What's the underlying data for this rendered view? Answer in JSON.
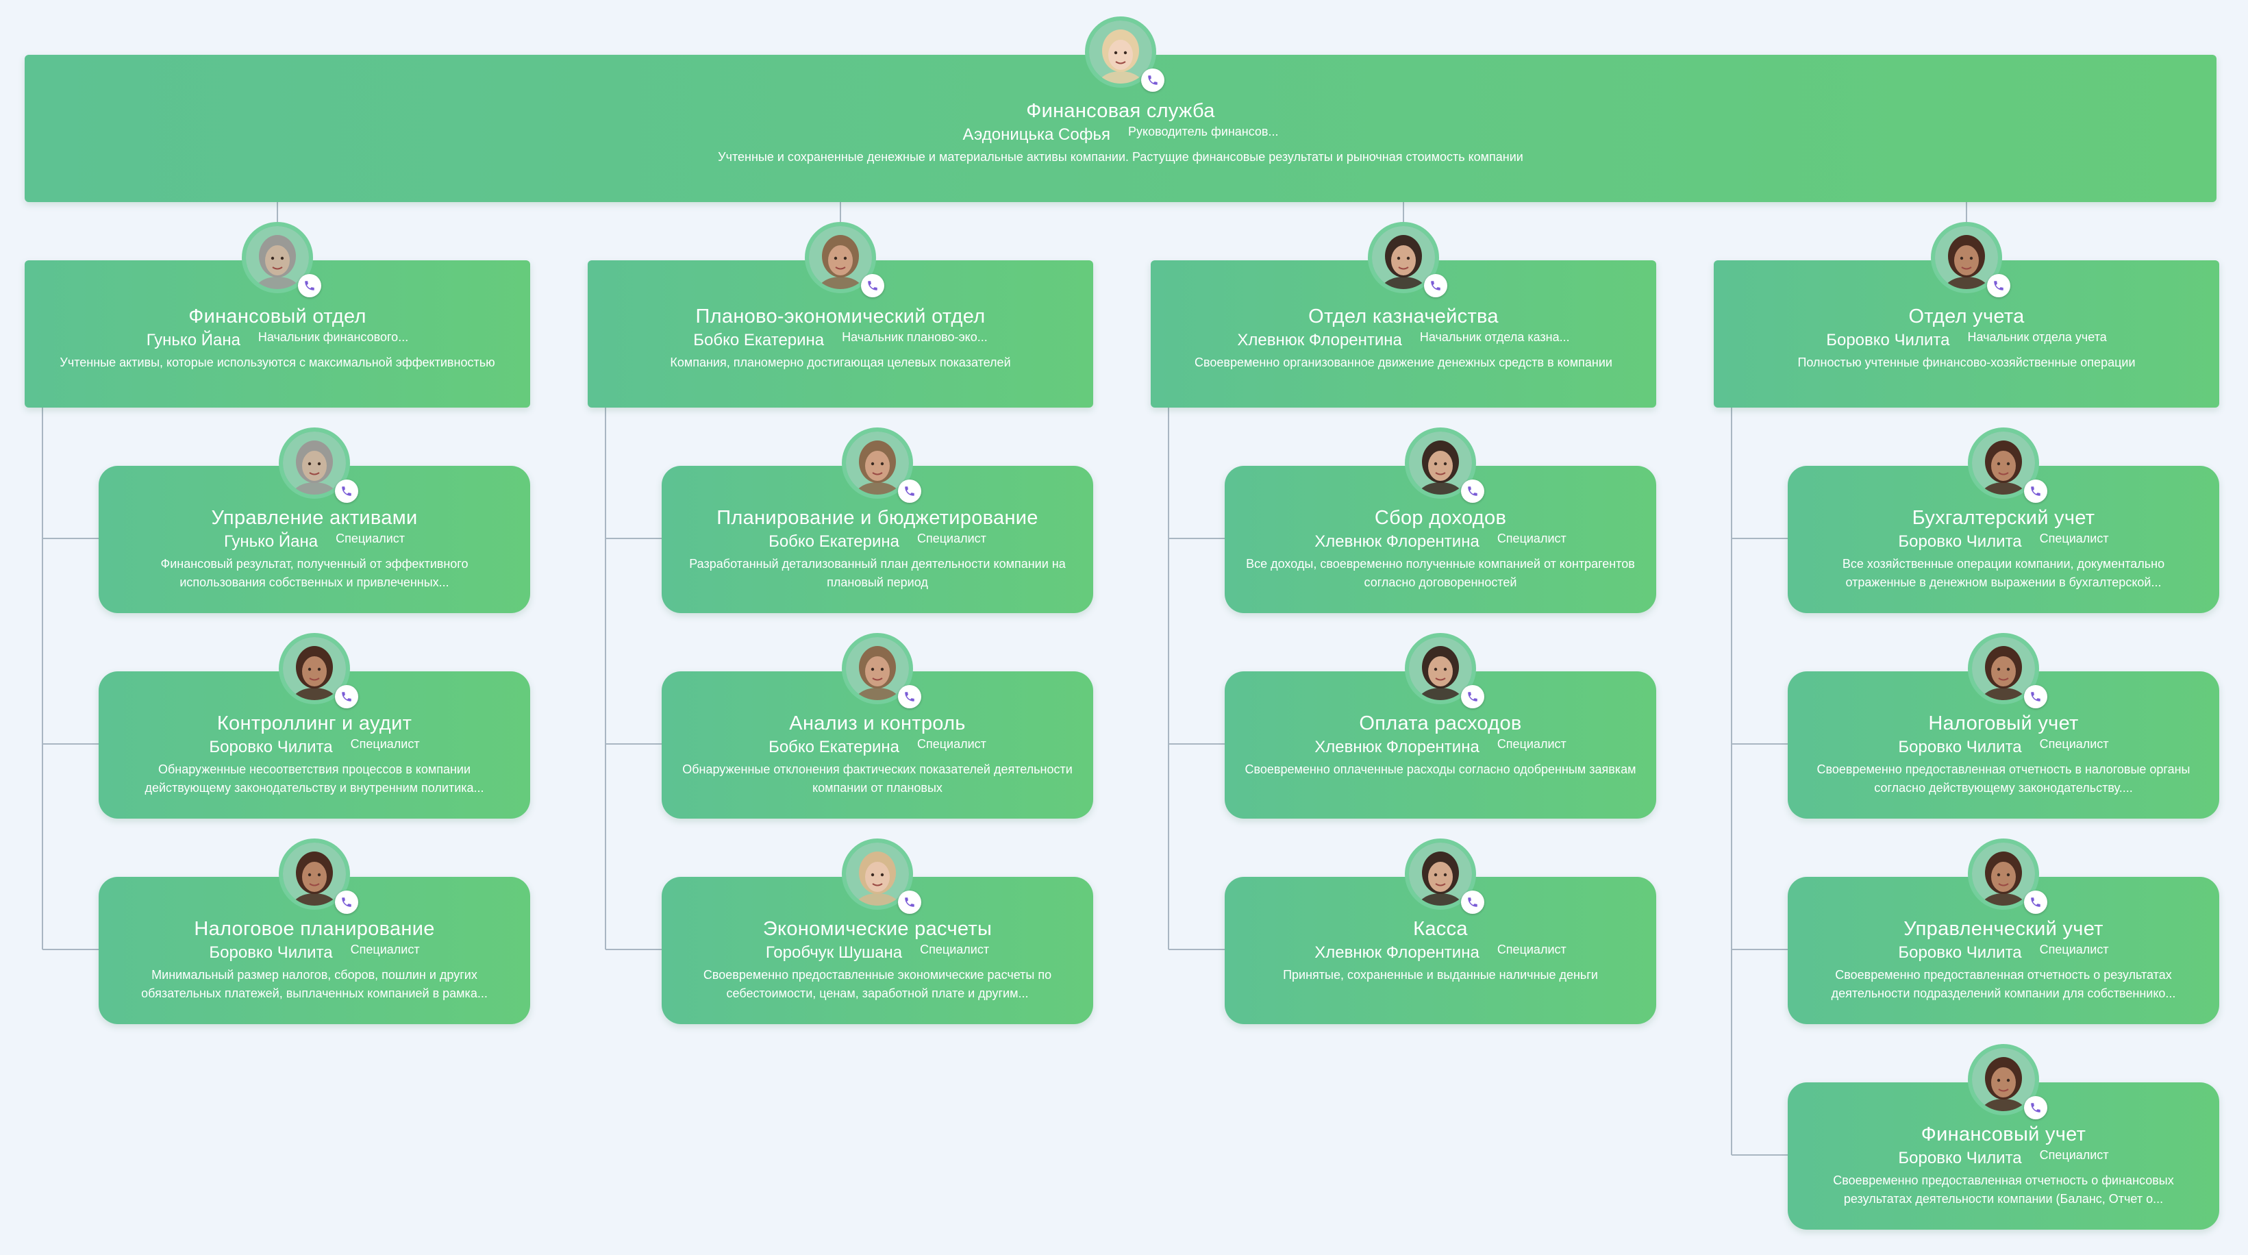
{
  "root": {
    "title": "Финансовая служба",
    "name": "Аэдоницька Софья",
    "role": "Руководитель финансов...",
    "desc": "Учтенные и сохраненные денежные и материальные активы компании. Растущие финансовые результаты и рыночная стоимость компании",
    "avatar": "person-2"
  },
  "departments": [
    {
      "title": "Финансовый отдел",
      "name": "Гунько Йана",
      "role": "Начальник финансового...",
      "desc": "Учтенные активы, которые используются с максимальной эффективностью",
      "avatar": "person-1",
      "teams": [
        {
          "title": "Управление активами",
          "name": "Гунько Йана",
          "role": "Специалист",
          "desc": "Финансовый результат, полученный от эффективного использования собственных и привлеченных...",
          "avatar": "person-1"
        },
        {
          "title": "Контроллинг и аудит",
          "name": "Боровко Чилита",
          "role": "Специалист",
          "desc": "Обнаруженные несоответствия процессов в компании действующему законодательству и внутренним политика...",
          "avatar": "person-3"
        },
        {
          "title": "Налоговое планирование",
          "name": "Боровко Чилита",
          "role": "Специалист",
          "desc": "Минимальный размер налогов, сборов, пошлин и других обязательных платежей, выплаченных компанией в рамка...",
          "avatar": "person-3"
        }
      ]
    },
    {
      "title": "Планово-экономический отдел",
      "name": "Бобко Екатерина",
      "role": "Начальник планово-эко...",
      "desc": "Компания, планомерно достигающая целевых показателей",
      "avatar": "person-4",
      "teams": [
        {
          "title": "Планирование и бюджетирование",
          "name": "Бобко Екатерина",
          "role": "Специалист",
          "desc": "Разработанный детализованный план деятельности компании на плановый период",
          "avatar": "person-4"
        },
        {
          "title": "Анализ и контроль",
          "name": "Бобко Екатерина",
          "role": "Специалист",
          "desc": "Обнаруженные отклонения фактических показателей деятельности компании от плановых",
          "avatar": "person-4"
        },
        {
          "title": "Экономические расчеты",
          "name": "Горобчук Шушана",
          "role": "Специалист",
          "desc": "Своевременно предоставленные экономические расчеты по себестоимости, ценам, заработной плате и другим...",
          "avatar": "person-5"
        }
      ]
    },
    {
      "title": "Отдел казначейства",
      "name": "Хлевнюк Флорентина",
      "role": "Начальник отдела казна...",
      "desc": "Своевременно организованное движение денежных средств в компании",
      "avatar": "person-6",
      "teams": [
        {
          "title": "Сбор доходов",
          "name": "Хлевнюк Флорентина",
          "role": "Специалист",
          "desc": "Все доходы, своевременно полученные компанией от контрагентов согласно договоренностей",
          "avatar": "person-6"
        },
        {
          "title": "Оплата расходов",
          "name": "Хлевнюк Флорентина",
          "role": "Специалист",
          "desc": "Своевременно оплаченные расходы согласно одобренным заявкам",
          "avatar": "person-6"
        },
        {
          "title": "Касса",
          "name": "Хлевнюк Флорентина",
          "role": "Специалист",
          "desc": "Принятые, сохраненные и выданные наличные деньги",
          "avatar": "person-6"
        }
      ]
    },
    {
      "title": "Отдел учета",
      "name": "Боровко Чилита",
      "role": "Начальник отдела учета",
      "desc": "Полностью учтенные финансово-хозяйственные операции",
      "avatar": "person-3",
      "teams": [
        {
          "title": "Бухгалтерский учет",
          "name": "Боровко Чилита",
          "role": "Специалист",
          "desc": "Все хозяйственные операции компании, документально отраженные в денежном выражении в бухгалтерской...",
          "avatar": "person-3"
        },
        {
          "title": "Налоговый учет",
          "name": "Боровко Чилита",
          "role": "Специалист",
          "desc": "Своевременно предоставленная отчетность в налоговые органы согласно действующему законодательству....",
          "avatar": "person-3"
        },
        {
          "title": "Управленческий учет",
          "name": "Боровко Чилита",
          "role": "Специалист",
          "desc": "Своевременно предоставленная отчетность о результатах деятельности подразделений компании для собственнико...",
          "avatar": "person-3"
        },
        {
          "title": "Финансовый учет",
          "name": "Боровко Чилита",
          "role": "Специалист",
          "desc": "Своевременно предоставленная отчетность о финансовых результатах деятельности компании (Баланс, Отчет о...",
          "avatar": "person-3"
        }
      ]
    }
  ],
  "portraits": {
    "person-1": {
      "skin": "#c9b49e",
      "hair": "#9a9a96"
    },
    "person-2": {
      "skin": "#f1d4be",
      "hair": "#e6cfa4"
    },
    "person-3": {
      "skin": "#b88566",
      "hair": "#4a2c20"
    },
    "person-4": {
      "skin": "#cfa083",
      "hair": "#8a6a4c"
    },
    "person-5": {
      "skin": "#e8c6ad",
      "hair": "#d6b98e"
    },
    "person-6": {
      "skin": "#d4a98c",
      "hair": "#3b2a22"
    }
  },
  "colors": {
    "background": "#f0f5fb",
    "card_start": "#5ec292",
    "card_end": "#66cb7c",
    "connector": "#a9b6c2",
    "phone_icon": "#7a5bd6"
  }
}
